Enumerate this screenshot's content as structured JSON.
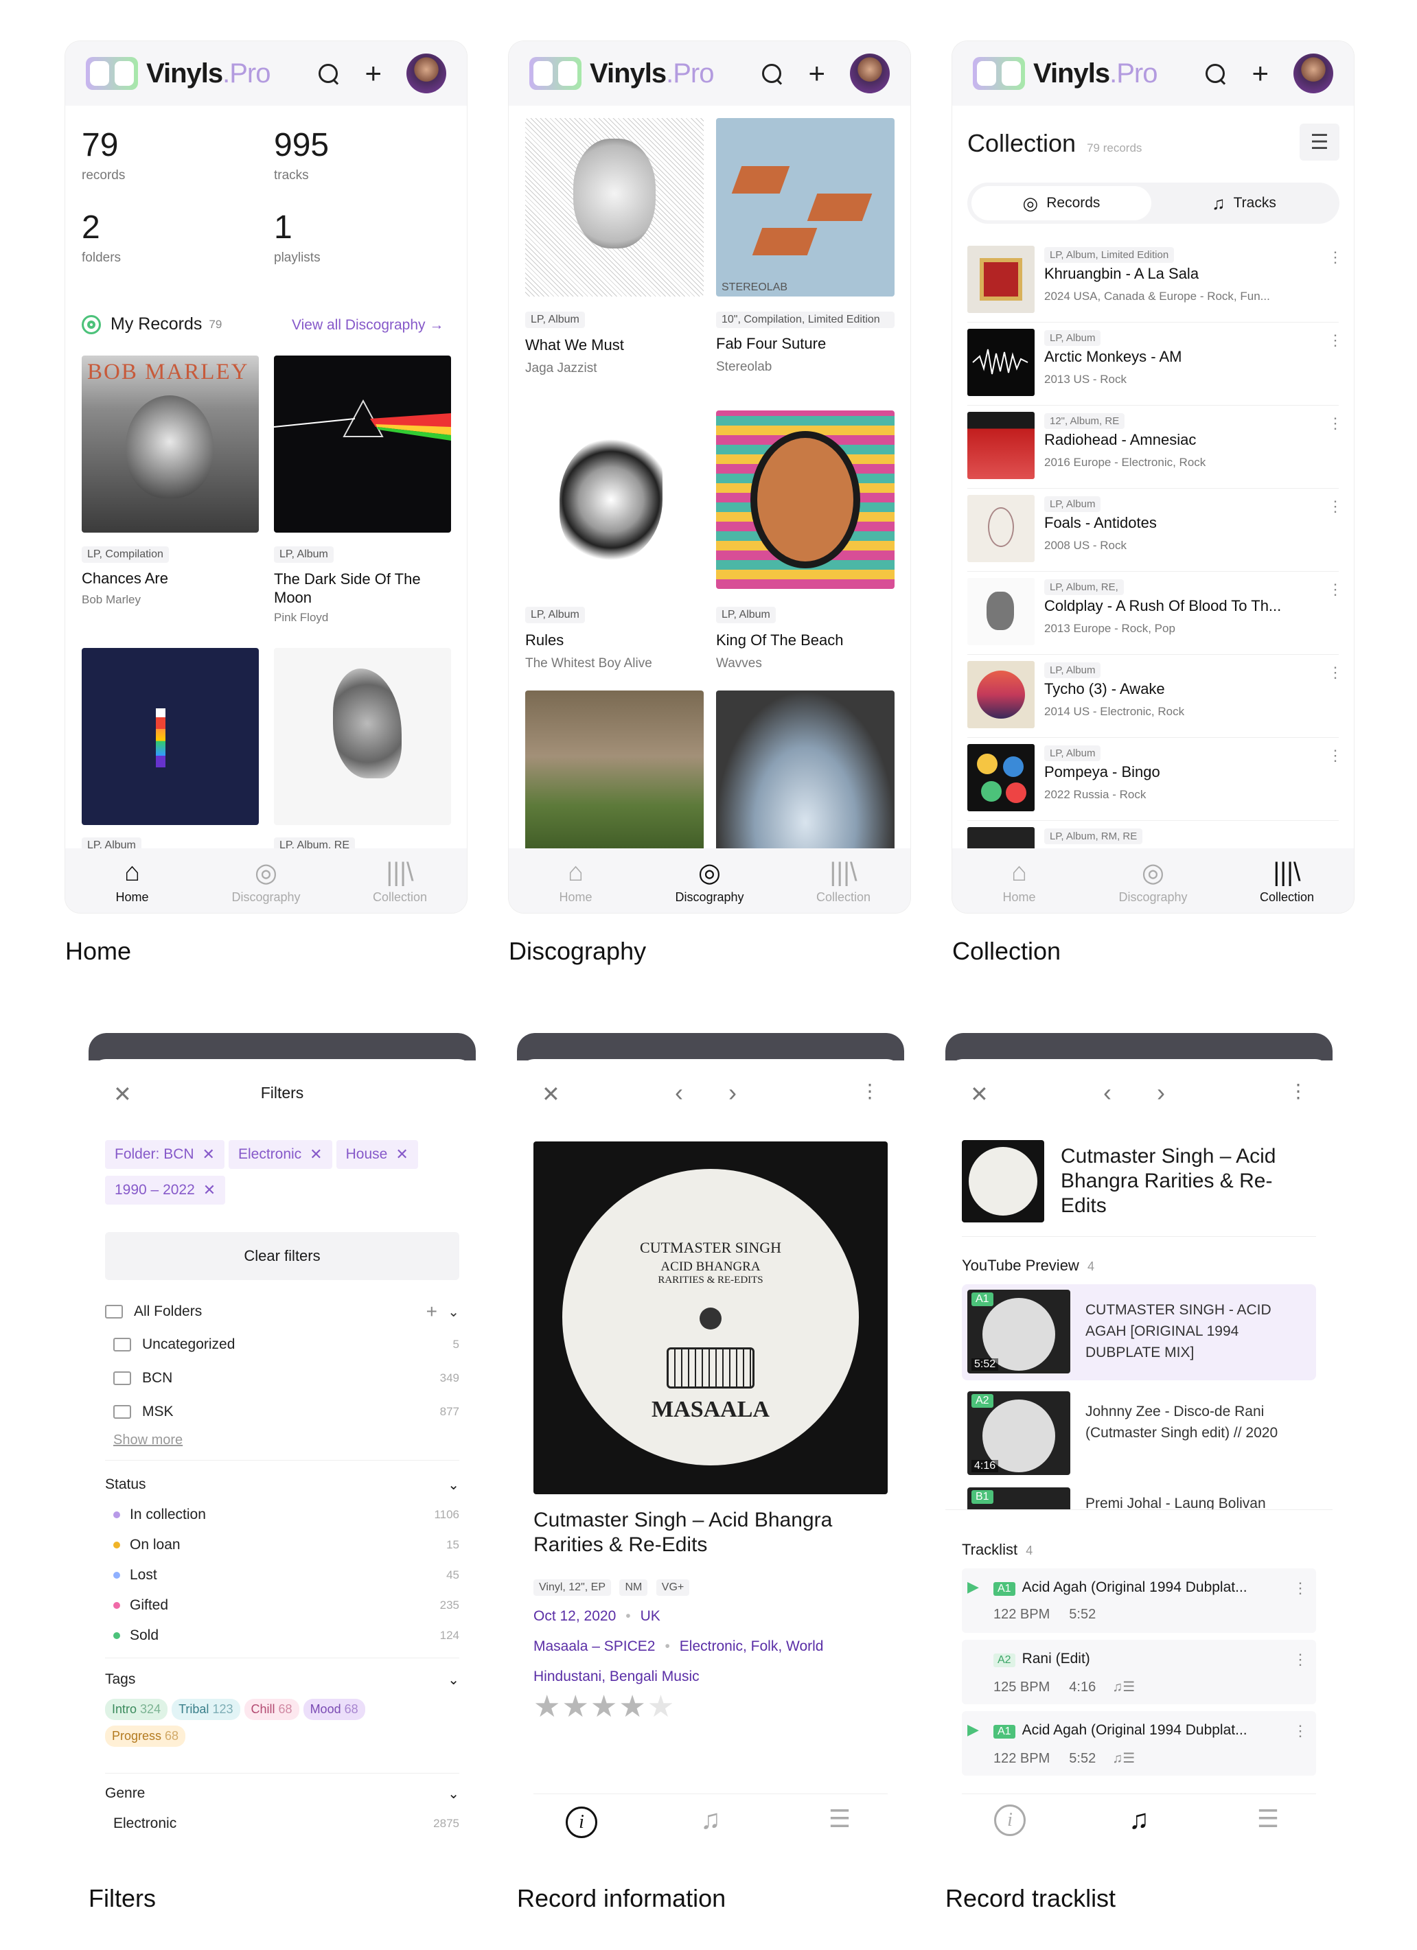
{
  "app": {
    "logo_main": "Vinyls",
    "logo_dot": ".",
    "logo_pro": "Pro"
  },
  "captions": {
    "home": "Home",
    "discography": "Discography",
    "collection": "Collection",
    "filters": "Filters",
    "record_information": "Record information",
    "record_tracklist": "Record tracklist"
  },
  "nav": {
    "home": "Home",
    "discography": "Discography",
    "collection": "Collection"
  },
  "home": {
    "stats": [
      {
        "value": "79",
        "label": "records"
      },
      {
        "value": "995",
        "label": "tracks"
      },
      {
        "value": "2",
        "label": "folders"
      },
      {
        "value": "1",
        "label": "playlists"
      }
    ],
    "section_title": "My Records",
    "section_count": "79",
    "view_all": "View all Discography →",
    "records": [
      {
        "format": "LP, Compilation",
        "title": "Chances Are",
        "artist": "Bob Marley"
      },
      {
        "format": "LP, Album",
        "title": "The Dark Side Of The Moon",
        "artist": "Pink Floyd"
      },
      {
        "format": "LP, Album",
        "title": "",
        "artist": ""
      },
      {
        "format": "LP, Album, RE",
        "title": "",
        "artist": ""
      }
    ],
    "cover_text_bob": "BOB MARLEY"
  },
  "discography": {
    "records": [
      {
        "format": "LP, Album",
        "title": "What We Must",
        "artist": "Jaga Jazzist"
      },
      {
        "format": "10\", Compilation, Limited Edition",
        "title": "Fab Four Suture",
        "artist": "Stereolab"
      },
      {
        "format": "LP, Album",
        "title": "Rules",
        "artist": "The Whitest Boy Alive"
      },
      {
        "format": "LP, Album",
        "title": "King Of The Beach",
        "artist": "Wavves"
      }
    ],
    "cover_text_stereolab": "STEREOLAB"
  },
  "collection": {
    "title": "Collection",
    "count": "79 records",
    "seg_records": "Records",
    "seg_tracks": "Tracks",
    "rows": [
      {
        "format": "LP, Album, Limited Edition",
        "name": "Khruangbin - A La Sala",
        "meta": "2024  USA, Canada & Europe  -  Rock, Fun..."
      },
      {
        "format": "LP, Album",
        "name": "Arctic Monkeys - AM",
        "meta": "2013  US  -  Rock"
      },
      {
        "format": "12\", Album, RE",
        "name": "Radiohead - Amnesiac",
        "meta": "2016  Europe  -  Electronic, Rock"
      },
      {
        "format": "LP, Album",
        "name": "Foals - Antidotes",
        "meta": "2008  US  -  Rock"
      },
      {
        "format": "LP, Album, RE,",
        "name": "Coldplay - A Rush Of Blood To Th...",
        "meta": "2013  Europe  -  Rock, Pop"
      },
      {
        "format": "LP, Album",
        "name": "Tycho (3) - Awake",
        "meta": "2014  US  -  Electronic, Rock"
      },
      {
        "format": "LP, Album",
        "name": "Pompeya - Bingo",
        "meta": "2022  Russia  -  Rock"
      },
      {
        "format": "LP, Album, RM, RE",
        "name": "",
        "meta": ""
      }
    ]
  },
  "filters": {
    "title": "Filters",
    "chips": [
      "Folder: BCN",
      "Electronic",
      "House",
      "1990 – 2022"
    ],
    "clear": "Clear filters",
    "all_folders": "All Folders",
    "folders": [
      {
        "name": "Uncategorized",
        "count": "5"
      },
      {
        "name": "BCN",
        "count": "349"
      },
      {
        "name": "MSK",
        "count": "877"
      }
    ],
    "show_more": "Show more",
    "status_title": "Status",
    "status": [
      {
        "name": "In collection",
        "count": "1106",
        "color": "#b89ae8"
      },
      {
        "name": "On loan",
        "count": "15",
        "color": "#f0b429"
      },
      {
        "name": "Lost",
        "count": "45",
        "color": "#8fb0ff"
      },
      {
        "name": "Gifted",
        "count": "235",
        "color": "#f06aa8"
      },
      {
        "name": "Sold",
        "count": "124",
        "color": "#4cc27a"
      }
    ],
    "tags_title": "Tags",
    "tags": [
      {
        "name": "Intro",
        "count": "324",
        "bg": "#dff3e6",
        "fg": "#3a8a5c"
      },
      {
        "name": "Tribal",
        "count": "123",
        "bg": "#e2f4f6",
        "fg": "#3a7f8a"
      },
      {
        "name": "Chill",
        "count": "68",
        "bg": "#fde8ef",
        "fg": "#b34b72"
      },
      {
        "name": "Mood",
        "count": "68",
        "bg": "#ecdffa",
        "fg": "#7a4bb3"
      },
      {
        "name": "Progress",
        "count": "68",
        "bg": "#fff0d6",
        "fg": "#b37a1f"
      }
    ],
    "genre_title": "Genre",
    "genre": [
      {
        "name": "Electronic",
        "count": "2875"
      }
    ]
  },
  "record": {
    "title": "Cutmaster Singh – Acid Bhangra Rarities & Re-Edits",
    "badges": [
      "Vinyl, 12\", EP",
      "NM",
      "VG+"
    ],
    "date": "Oct 12, 2020",
    "country": "UK",
    "label": "Masaala – SPICE2",
    "genres": "Electronic, Folk, World",
    "styles": "Hindustani, Bengali Music",
    "rating": 4,
    "label_line1": "CUTMASTER  SINGH",
    "label_line2": "ACID BHANGRA",
    "label_line3": "RARITIES & RE-EDITS",
    "label_brand": "MASAALA"
  },
  "tracklist": {
    "title": "Cutmaster Singh – Acid Bhangra Rarities & Re-Edits",
    "yt_title": "YouTube Preview",
    "yt_count": "4",
    "yt": [
      {
        "pos": "A1",
        "dur": "5:52",
        "text": "CUTMASTER SINGH - ACID AGAH [ORIGINAL 1994 DUBPLATE MIX]"
      },
      {
        "pos": "A2",
        "dur": "4:16",
        "text": "Johnny Zee - Disco-de Rani (Cutmaster Singh edit) // 2020"
      },
      {
        "pos": "B1",
        "dur": "",
        "text": "Premi Johal - Laung Bolivan"
      }
    ],
    "tl_title": "Tracklist",
    "tl_count": "4",
    "tracks": [
      {
        "pos": "A1",
        "name": "Acid Agah (Original 1994 Dubplat...",
        "bpm": "122 BPM",
        "dur": "5:52"
      },
      {
        "pos": "A2",
        "name": "Rani (Edit)",
        "bpm": "125 BPM",
        "dur": "4:16"
      },
      {
        "pos": "A1",
        "name": "Acid Agah (Original 1994 Dubplat...",
        "bpm": "122 BPM",
        "dur": "5:52"
      }
    ]
  },
  "colors": {
    "accent": "#8659c9",
    "green": "#4cc27a"
  }
}
